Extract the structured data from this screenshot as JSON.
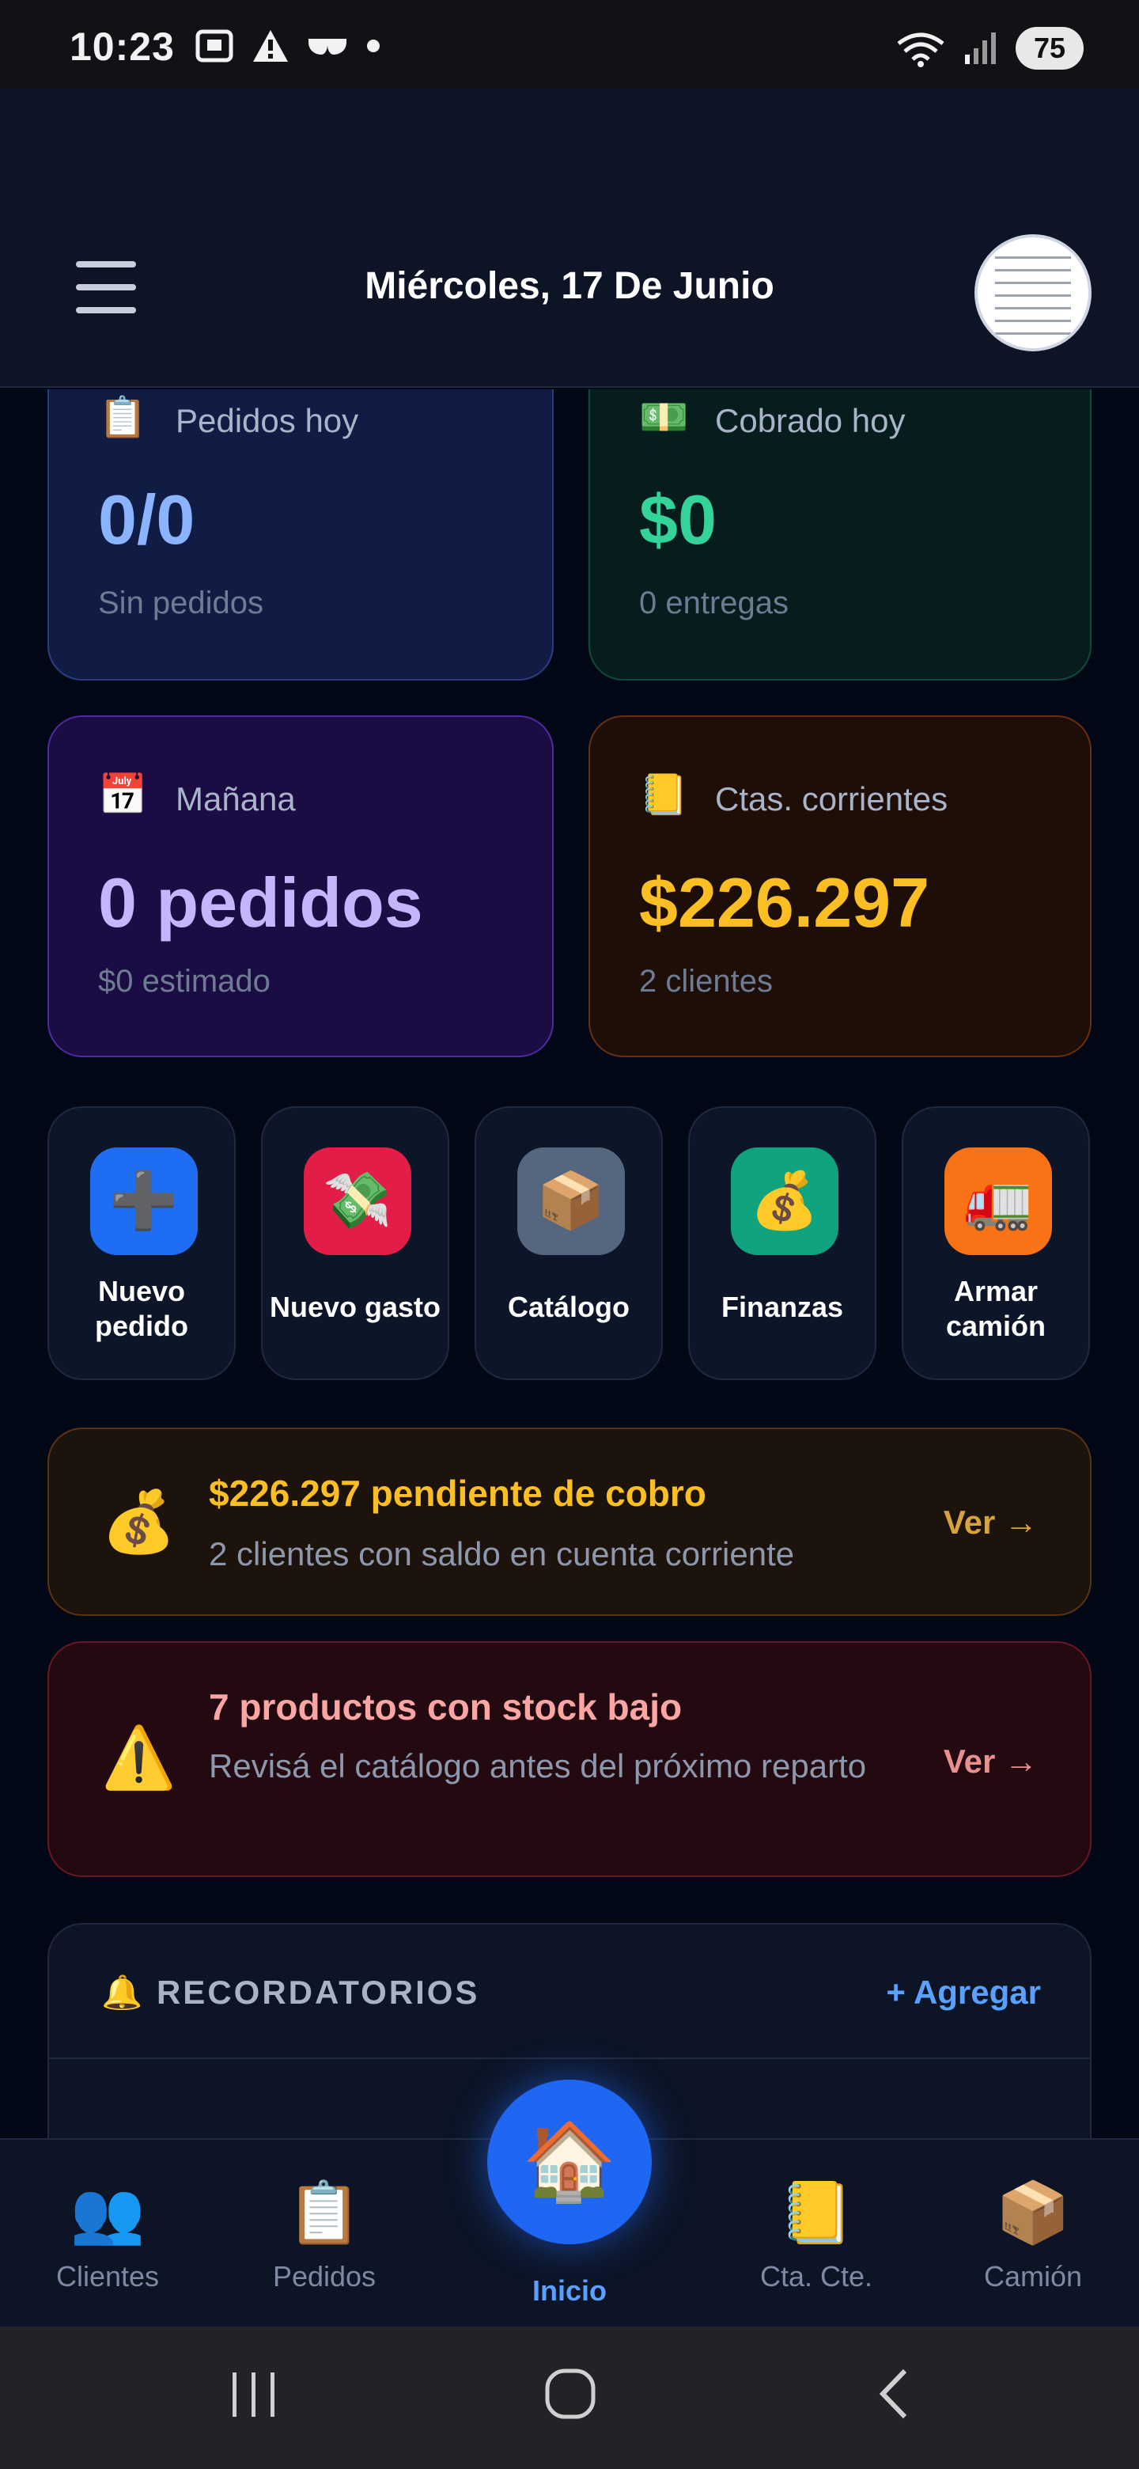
{
  "status_bar": {
    "time": "10:23",
    "battery": "75"
  },
  "header": {
    "date": "Miércoles, 17 De Junio"
  },
  "stats": [
    {
      "icon": "📋",
      "label": "Pedidos hoy",
      "value": "0/0",
      "sub": "Sin pedidos",
      "color": "#8ab4ff"
    },
    {
      "icon": "💵",
      "label": "Cobrado hoy",
      "value": "$0",
      "sub": "0 entregas",
      "color": "#34d399"
    },
    {
      "icon": "📅",
      "label": "Mañana",
      "value": "0 pedidos",
      "sub": "$0 estimado",
      "color": "#c4b5fd"
    },
    {
      "icon": "📒",
      "label": "Ctas. corrientes",
      "value": "$226.297",
      "sub": "2 clientes",
      "color": "#fbbf24"
    }
  ],
  "quick_actions": [
    {
      "icon": "➕",
      "label": "Nuevo pedido",
      "bg": "#1f6df2"
    },
    {
      "icon": "💸",
      "label": "Nuevo gasto",
      "bg": "#e11d48"
    },
    {
      "icon": "📦",
      "label": "Catálogo",
      "bg": "#55667f"
    },
    {
      "icon": "💰",
      "label": "Finanzas",
      "bg": "#10a37f"
    },
    {
      "icon": "🚛",
      "label": "Armar camión",
      "bg": "#f97316"
    }
  ],
  "alerts": [
    {
      "icon": "💰",
      "title": "$226.297 pendiente de cobro",
      "sub": "2 clientes con saldo en cuenta corriente",
      "link": "Ver →",
      "title_color": "#fbbf24",
      "link_color": "#d6a43a"
    },
    {
      "icon": "⚠️",
      "title": "7 productos con stock bajo",
      "sub": "Revisá el catálogo antes del próximo reparto",
      "link": "Ver →",
      "title_color": "#fca5a5",
      "link_color": "#e88f8f"
    }
  ],
  "reminders": {
    "icon": "🔔",
    "title": "RECORDATORIOS",
    "add_label": "+ Agregar"
  },
  "bottom_nav": [
    {
      "icon": "👥",
      "label": "Clientes"
    },
    {
      "icon": "📋",
      "label": "Pedidos"
    },
    {
      "icon": "🏠",
      "label": "Inicio",
      "active": true
    },
    {
      "icon": "📒",
      "label": "Cta. Cte."
    },
    {
      "icon": "📦",
      "label": "Camión"
    }
  ]
}
